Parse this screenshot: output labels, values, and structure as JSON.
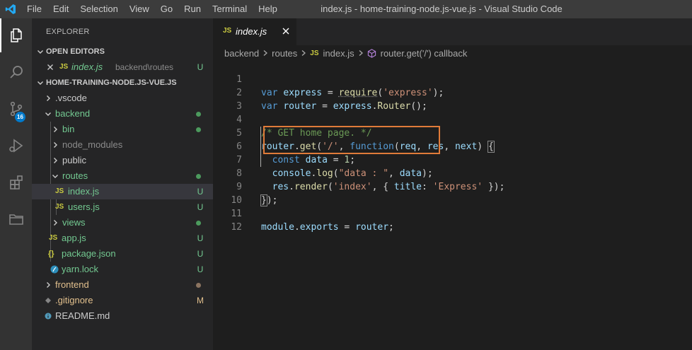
{
  "menu": [
    "File",
    "Edit",
    "Selection",
    "View",
    "Go",
    "Run",
    "Terminal",
    "Help"
  ],
  "window_title": "index.js - home-training-node.js-vue.js - Visual Studio Code",
  "activity_bar": {
    "items": [
      "explorer-icon",
      "search-icon",
      "source-control-icon",
      "run-debug-icon",
      "extensions-icon",
      "remote-explorer-icon"
    ],
    "source_control_badge": "16"
  },
  "sidebar": {
    "title": "EXPLORER",
    "open_editors": {
      "label": "OPEN EDITORS",
      "items": [
        {
          "icon": "JS",
          "name": "index.js",
          "path": "backend\\routes",
          "status": "U"
        }
      ]
    },
    "project": {
      "label": "HOME-TRAINING-NODE.JS-VUE.JS",
      "tree": [
        {
          "name": ".vscode",
          "type": "folder",
          "expanded": false
        },
        {
          "name": "backend",
          "type": "folder",
          "expanded": true,
          "status": "dot"
        },
        {
          "name": "bin",
          "type": "folder",
          "expanded": false,
          "status": "dot"
        },
        {
          "name": "node_modules",
          "type": "folder",
          "expanded": false
        },
        {
          "name": "public",
          "type": "folder",
          "expanded": false
        },
        {
          "name": "routes",
          "type": "folder",
          "expanded": true,
          "status": "dot"
        },
        {
          "name": "index.js",
          "icon": "JS",
          "status": "U",
          "selected": true
        },
        {
          "name": "users.js",
          "icon": "JS",
          "status": "U"
        },
        {
          "name": "views",
          "type": "folder",
          "expanded": false,
          "status": "dot"
        },
        {
          "name": "app.js",
          "icon": "JS",
          "status": "U"
        },
        {
          "name": "package.json",
          "icon": "{}",
          "status": "U"
        },
        {
          "name": "yarn.lock",
          "icon": "yarn",
          "status": "U"
        },
        {
          "name": "frontend",
          "type": "folder",
          "expanded": false,
          "status": "dot"
        },
        {
          "name": ".gitignore",
          "status": "M"
        },
        {
          "name": "README.md"
        }
      ]
    }
  },
  "editor": {
    "tab": {
      "icon": "JS",
      "label": "index.js"
    },
    "breadcrumbs": [
      "backend",
      "routes",
      "index.js",
      "router.get('/') callback"
    ],
    "line_numbers": [
      "1",
      "2",
      "3",
      "4",
      "5",
      "6",
      "7",
      "8",
      "9",
      "10",
      "11",
      "12"
    ],
    "code": [
      "var express = require('express');",
      "var router = express.Router();",
      "",
      "/* GET home page. */",
      "router.get('/', function(req, res, next) {",
      "  const data = 1;",
      "  console.log(\"data : \", data);",
      "  res.render('index', { title: 'Express' });",
      "});",
      "",
      "module.exports = router;",
      ""
    ]
  },
  "colors": {
    "accent": "#007acc",
    "highlight_box": "#e07b39",
    "untracked": "#73c991",
    "modified": "#e2c08d",
    "js_icon": "#cbcb41"
  }
}
